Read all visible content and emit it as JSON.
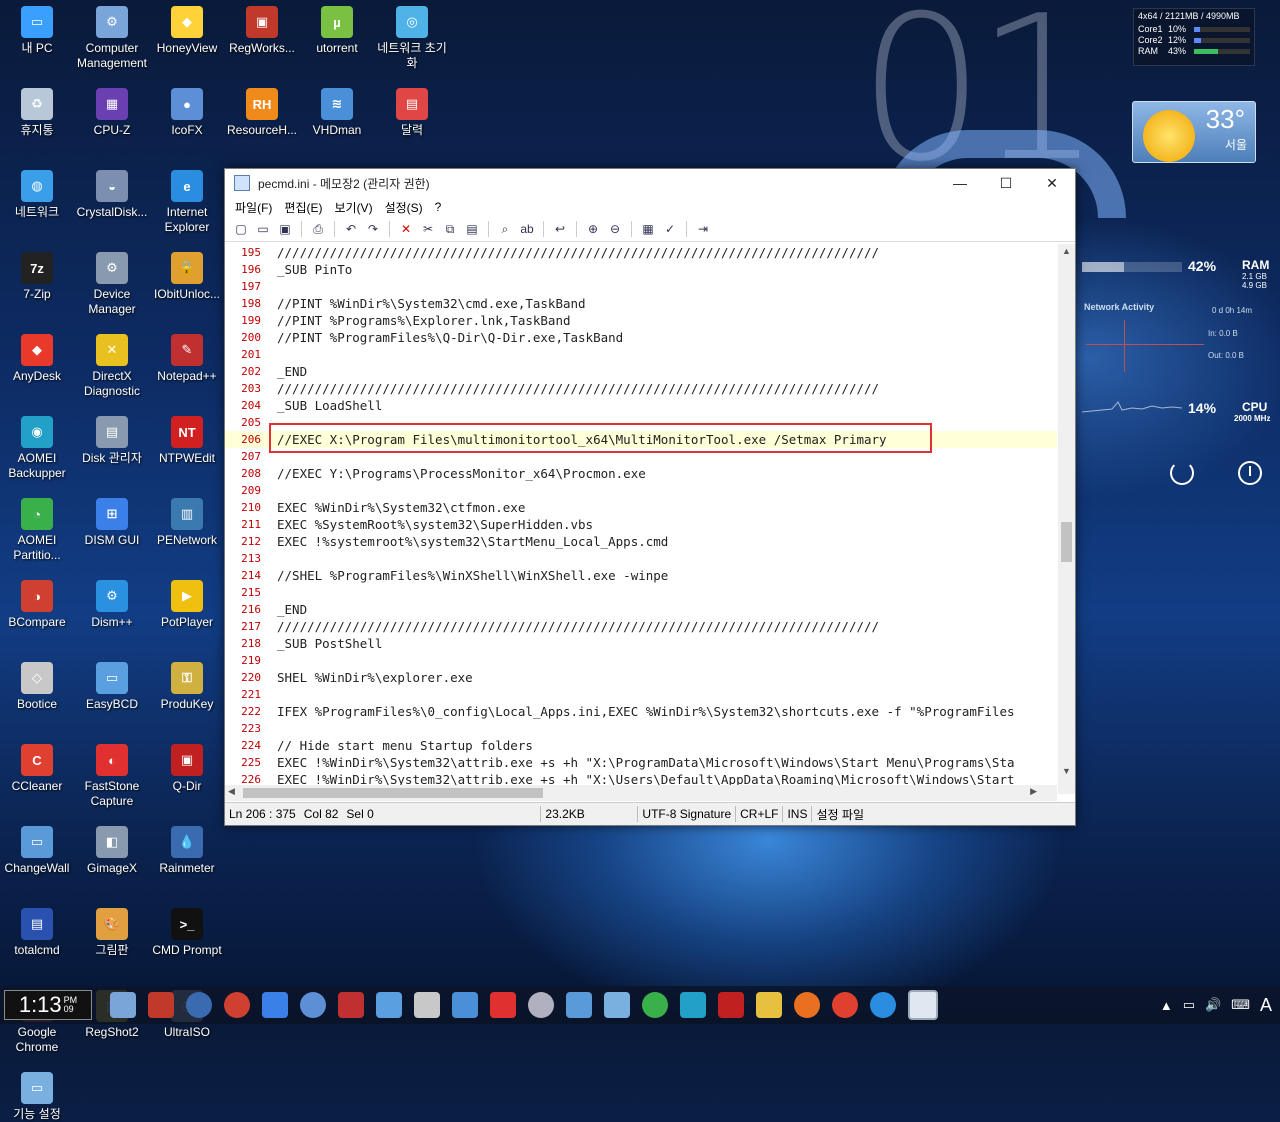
{
  "desktop": {
    "icons": [
      {
        "label": "내 PC",
        "color": "#3aa0ff",
        "glyph": "▭"
      },
      {
        "label": "Computer Management",
        "color": "#7aa5d8",
        "glyph": "⚙"
      },
      {
        "label": "HoneyView",
        "color": "#ffd23a",
        "glyph": "◆"
      },
      {
        "label": "RegWorks...",
        "color": "#c0392b",
        "glyph": "▣"
      },
      {
        "label": "utorrent",
        "color": "#7ac143",
        "glyph": "µ"
      },
      {
        "label": "네트워크 초기화",
        "color": "#4fb3e8",
        "glyph": "◎"
      },
      {
        "label": "휴지통",
        "color": "#b8c8d8",
        "glyph": "♻"
      },
      {
        "label": "CPU-Z",
        "color": "#6a3fb0",
        "glyph": "▦"
      },
      {
        "label": "IcoFX",
        "color": "#5d8fd6",
        "glyph": "●"
      },
      {
        "label": "ResourceH...",
        "color": "#f08a1a",
        "glyph": "RH"
      },
      {
        "label": "VHDman",
        "color": "#4a90d9",
        "glyph": "≋"
      },
      {
        "label": "달력",
        "color": "#e04646",
        "glyph": "▤"
      },
      {
        "label": "네트워크",
        "color": "#3a9fe8",
        "glyph": "◍"
      },
      {
        "label": "CrystalDisk...",
        "color": "#7d8fb0",
        "glyph": "◒"
      },
      {
        "label": "Internet Explorer",
        "color": "#2a8de0",
        "glyph": "e"
      },
      {
        "label": "7-Zip",
        "color": "#222222",
        "glyph": "7z"
      },
      {
        "label": "Device Manager",
        "color": "#8a9aae",
        "glyph": "⚙"
      },
      {
        "label": "IObitUnloc...",
        "color": "#e0a030",
        "glyph": "🔒"
      },
      {
        "label": "AnyDesk",
        "color": "#e8392b",
        "glyph": "◆"
      },
      {
        "label": "DirectX Diagnostic",
        "color": "#e8c020",
        "glyph": "✕"
      },
      {
        "label": "Notepad++",
        "color": "#c03030",
        "glyph": "✎"
      },
      {
        "label": "AOMEI Backupper",
        "color": "#22a0c8",
        "glyph": "◉"
      },
      {
        "label": "Disk 관리자",
        "color": "#8a9aae",
        "glyph": "▤"
      },
      {
        "label": "NTPWEdit",
        "color": "#d02020",
        "glyph": "NT"
      },
      {
        "label": "AOMEI Partitio...",
        "color": "#3ab04a",
        "glyph": "◔"
      },
      {
        "label": "DISM GUI",
        "color": "#3a80e8",
        "glyph": "⊞"
      },
      {
        "label": "PENetwork",
        "color": "#3a7ab0",
        "glyph": "▥"
      },
      {
        "label": "BCompare",
        "color": "#d04030",
        "glyph": "◑"
      },
      {
        "label": "Dism++",
        "color": "#2a90e0",
        "glyph": "⚙"
      },
      {
        "label": "PotPlayer",
        "color": "#f0c010",
        "glyph": "▶"
      },
      {
        "label": "Bootice",
        "color": "#c8c8c8",
        "glyph": "◇"
      },
      {
        "label": "EasyBCD",
        "color": "#5aa0e0",
        "glyph": "▭"
      },
      {
        "label": "ProduKey",
        "color": "#d0b040",
        "glyph": "⚿"
      },
      {
        "label": "CCleaner",
        "color": "#e04030",
        "glyph": "C"
      },
      {
        "label": "FastStone Capture",
        "color": "#e03030",
        "glyph": "◐"
      },
      {
        "label": "Q-Dir",
        "color": "#c02020",
        "glyph": "▣"
      },
      {
        "label": "ChangeWall",
        "color": "#5a9ad8",
        "glyph": "▭"
      },
      {
        "label": "GimageX",
        "color": "#8a9aae",
        "glyph": "◧"
      },
      {
        "label": "Rainmeter",
        "color": "#3a6ab0",
        "glyph": "💧"
      },
      {
        "label": "totalcmd",
        "color": "#2a50b0",
        "glyph": "▤"
      },
      {
        "label": "그림판",
        "color": "#e0a040",
        "glyph": "🎨"
      },
      {
        "label": "CMD Prompt",
        "color": "#111111",
        "glyph": ">_"
      },
      {
        "label": "Google Chrome",
        "color": "#e04030",
        "glyph": "◉"
      },
      {
        "label": "RegShot2",
        "color": "#e0c020",
        "glyph": "▦"
      },
      {
        "label": "UltraISO",
        "color": "#b0b0c0",
        "glyph": "◎"
      },
      {
        "label": "기능 설정",
        "color": "#7ab0e0",
        "glyph": "▭"
      }
    ]
  },
  "widgets": {
    "big_clock": "01",
    "sysmon": {
      "header": "4x64 / 2121MB / 4990MB",
      "rows": [
        {
          "label": "Core1",
          "value": "10%",
          "pct": 10
        },
        {
          "label": "Core2",
          "value": "12%",
          "pct": 12
        },
        {
          "label": "RAM",
          "value": "43%",
          "pct": 43
        }
      ]
    },
    "weather": {
      "temp": "33°",
      "city": "서울"
    },
    "ram_gauge": {
      "pct": "42%",
      "label": "RAM",
      "used": "2.1 GB",
      "total": "4.9 GB"
    },
    "network": {
      "title": "Network Activity",
      "uptime": "0 d 0h 14m",
      "in": "In: 0.0 B",
      "out": "Out: 0.0 B"
    },
    "cpu_gauge": {
      "pct": "14%",
      "label": "CPU",
      "freq": "2000 MHz"
    }
  },
  "notepad": {
    "title": "pecmd.ini - 메모장2 (관리자 권한)",
    "menu": [
      "파일(F)",
      "편집(E)",
      "보기(V)",
      "설정(S)",
      "?"
    ],
    "lines": [
      {
        "n": "195",
        "t": "////////////////////////////////////////////////////////////////////////////////"
      },
      {
        "n": "196",
        "t": "_SUB PinTo"
      },
      {
        "n": "197",
        "t": ""
      },
      {
        "n": "198",
        "t": "//PINT %WinDir%\\System32\\cmd.exe,TaskBand"
      },
      {
        "n": "199",
        "t": "//PINT %Programs%\\Explorer.lnk,TaskBand"
      },
      {
        "n": "200",
        "t": "//PINT %ProgramFiles%\\Q-Dir\\Q-Dir.exe,TaskBand"
      },
      {
        "n": "201",
        "t": ""
      },
      {
        "n": "202",
        "t": "_END"
      },
      {
        "n": "203",
        "t": "////////////////////////////////////////////////////////////////////////////////"
      },
      {
        "n": "204",
        "t": "_SUB LoadShell"
      },
      {
        "n": "205",
        "t": ""
      },
      {
        "n": "206",
        "t": "//EXEC X:\\Program Files\\multimonitortool_x64\\MultiMonitorTool.exe /Setmax Primary"
      },
      {
        "n": "207",
        "t": ""
      },
      {
        "n": "208",
        "t": "//EXEC Y:\\Programs\\ProcessMonitor_x64\\Procmon.exe"
      },
      {
        "n": "209",
        "t": ""
      },
      {
        "n": "210",
        "t": "EXEC %WinDir%\\System32\\ctfmon.exe"
      },
      {
        "n": "211",
        "t": "EXEC %SystemRoot%\\system32\\SuperHidden.vbs"
      },
      {
        "n": "212",
        "t": "EXEC !%systemroot%\\system32\\StartMenu_Local_Apps.cmd"
      },
      {
        "n": "213",
        "t": ""
      },
      {
        "n": "214",
        "t": "//SHEL %ProgramFiles%\\WinXShell\\WinXShell.exe -winpe"
      },
      {
        "n": "215",
        "t": ""
      },
      {
        "n": "216",
        "t": "_END"
      },
      {
        "n": "217",
        "t": "////////////////////////////////////////////////////////////////////////////////"
      },
      {
        "n": "218",
        "t": "_SUB PostShell"
      },
      {
        "n": "219",
        "t": ""
      },
      {
        "n": "220",
        "t": "SHEL %WinDir%\\explorer.exe"
      },
      {
        "n": "221",
        "t": ""
      },
      {
        "n": "222",
        "t": "IFEX %ProgramFiles%\\0_config\\Local_Apps.ini,EXEC %WinDir%\\System32\\shortcuts.exe -f \"%ProgramFiles"
      },
      {
        "n": "223",
        "t": ""
      },
      {
        "n": "224",
        "t": "// Hide start menu Startup folders"
      },
      {
        "n": "225",
        "t": "EXEC !%WinDir%\\System32\\attrib.exe +s +h \"X:\\ProgramData\\Microsoft\\Windows\\Start Menu\\Programs\\Sta"
      },
      {
        "n": "226",
        "t": "EXEC !%WinDir%\\System32\\attrib.exe +s +h \"X:\\Users\\Default\\AppData\\Roaming\\Microsoft\\Windows\\Start"
      }
    ],
    "status": {
      "pos": "Ln 206 : 375",
      "col": "Col 82",
      "sel": "Sel 0",
      "size": "23.2KB",
      "encoding": "UTF-8 Signature",
      "eol": "CR+LF",
      "ins": "INS",
      "scheme": "설정 파일"
    }
  },
  "taskbar": {
    "time": "1:13",
    "ampm": "PM",
    "seconds": "09",
    "tray_ime": "A"
  }
}
